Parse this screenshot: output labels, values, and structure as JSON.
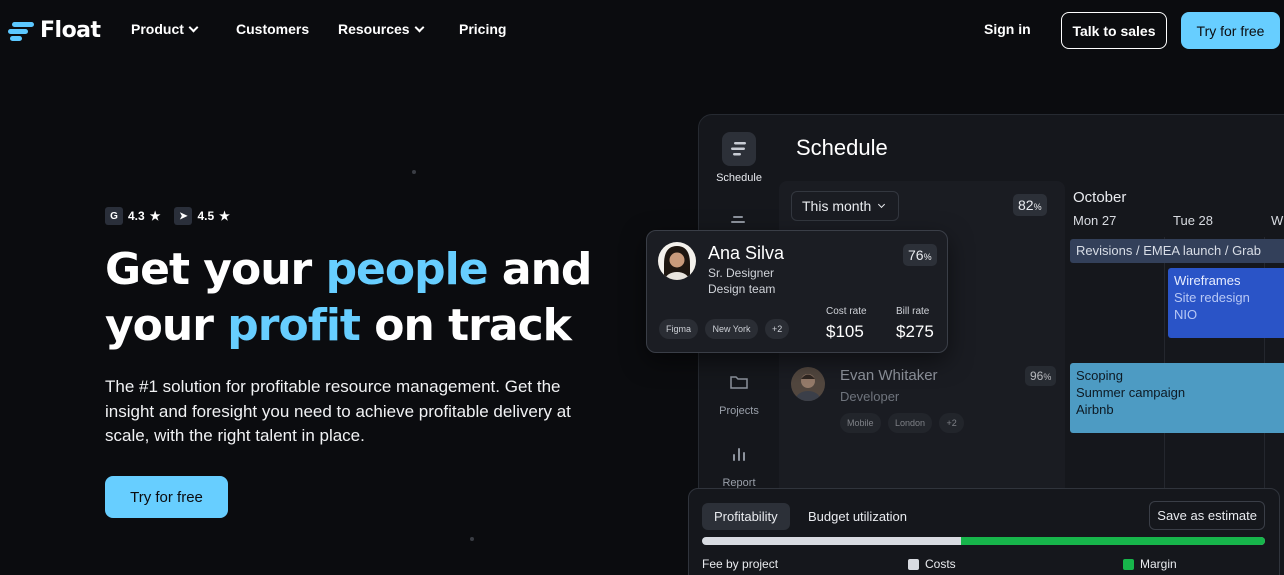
{
  "nav": {
    "logo_text": "Float",
    "product": "Product",
    "customers": "Customers",
    "resources": "Resources",
    "pricing": "Pricing",
    "sign_in": "Sign in",
    "talk_to_sales": "Talk to sales",
    "try_free": "Try for free"
  },
  "hero": {
    "rating_g2": "4.3",
    "rating_capterra": "4.5",
    "star": "★",
    "headline_1": "Get your ",
    "headline_accent_1": "people",
    "headline_2": " and",
    "headline_3": "your ",
    "headline_accent_2": "profit",
    "headline_4": " on track",
    "subtitle": "The #1 solution for profitable resource management. Get the insight and foresight you need to achieve profitable delivery at scale, with the right talent in place.",
    "cta": "Try for free"
  },
  "app": {
    "title": "Schedule",
    "sidebar": [
      {
        "label": "Schedule",
        "icon": "schedule-icon"
      },
      {
        "label": "",
        "icon": "people-icon"
      },
      {
        "label": "Projects",
        "icon": "folder-icon"
      },
      {
        "label": "Report",
        "icon": "report-icon"
      }
    ],
    "month_selector": "This month",
    "overall_pct": "82",
    "pct_sign": "%",
    "calendar_month": "October",
    "days": [
      "Mon 27",
      "Tue 28",
      "W"
    ],
    "bars": [
      {
        "text": "Revisions / EMEA launch / Grab",
        "color": "#3a4a66"
      },
      {
        "line1": "Wireframes",
        "line2": "Site redesign",
        "line3": "NIO",
        "color": "#2b55c9"
      },
      {
        "line1": "Scoping",
        "line2": "Summer campaign",
        "line3": "Airbnb",
        "color": "#4d9cc4"
      }
    ],
    "person1": {
      "name": "Ana Silva",
      "role": "Sr. Designer",
      "team": "Design team",
      "pct": "76",
      "tags": [
        "Figma",
        "New York",
        "+2"
      ],
      "cost_label": "Cost rate",
      "cost_value": "$105",
      "bill_label": "Bill rate",
      "bill_value": "$275"
    },
    "person2": {
      "name": "Evan Whitaker",
      "role": "Developer",
      "pct": "96",
      "tags": [
        "Mobile",
        "London",
        "+2"
      ]
    },
    "profitability": {
      "tab_active": "Profitability",
      "tab_other": "Budget utilization",
      "save_estimate": "Save as estimate",
      "costs_fraction": 0.46,
      "margin_fraction": 0.54,
      "fee_label": "Fee by project",
      "costs_label": "Costs",
      "margin_label": "Margin"
    }
  },
  "colors": {
    "accent": "#67ceff",
    "background": "#0b0c0f",
    "margin_green": "#17b54b"
  }
}
